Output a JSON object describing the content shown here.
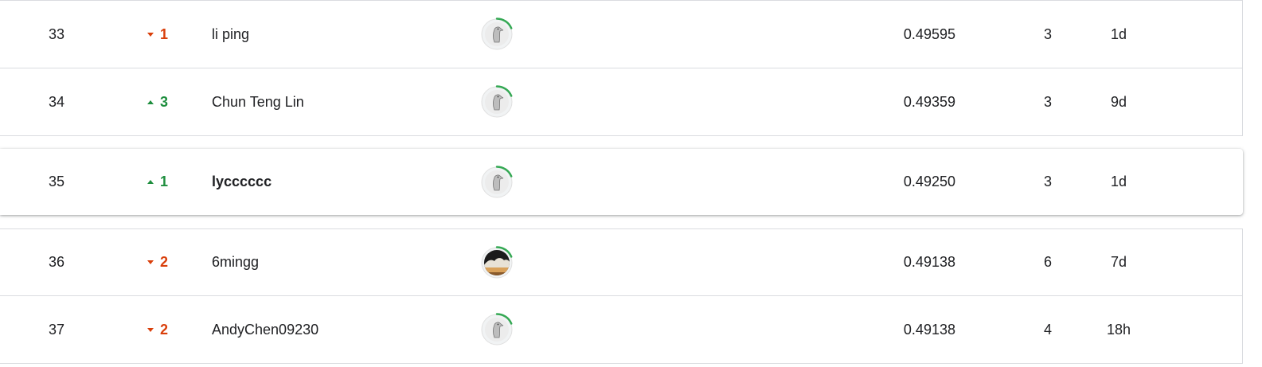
{
  "leaderboard": {
    "rows": [
      {
        "rank": "33",
        "change_dir": "down",
        "change": "1",
        "name": "li ping",
        "avatar": "goose-avatar-icon",
        "score": "0.49595",
        "entries": "3",
        "last": "1d",
        "highlighted": false,
        "tier_progress": 0.25
      },
      {
        "rank": "34",
        "change_dir": "up",
        "change": "3",
        "name": "Chun Teng Lin",
        "avatar": "goose-avatar-icon",
        "score": "0.49359",
        "entries": "3",
        "last": "9d",
        "highlighted": false,
        "tier_progress": 0.25
      },
      {
        "rank": "35",
        "change_dir": "up",
        "change": "1",
        "name": "lycccccc",
        "avatar": "goose-avatar-icon",
        "score": "0.49250",
        "entries": "3",
        "last": "1d",
        "highlighted": true,
        "tier_progress": 0.25
      },
      {
        "rank": "36",
        "change_dir": "down",
        "change": "2",
        "name": "6mingg",
        "avatar": "landscape-avatar-icon",
        "score": "0.49138",
        "entries": "6",
        "last": "7d",
        "highlighted": false,
        "tier_progress": 0.25
      },
      {
        "rank": "37",
        "change_dir": "down",
        "change": "2",
        "name": "AndyChen09230",
        "avatar": "goose-avatar-icon",
        "score": "0.49138",
        "entries": "4",
        "last": "18h",
        "highlighted": false,
        "tier_progress": 0.25
      }
    ]
  },
  "colors": {
    "up": "#1e8e3e",
    "down": "#d93f0b",
    "progress_ring": "#34a853",
    "border": "#dadce0"
  }
}
